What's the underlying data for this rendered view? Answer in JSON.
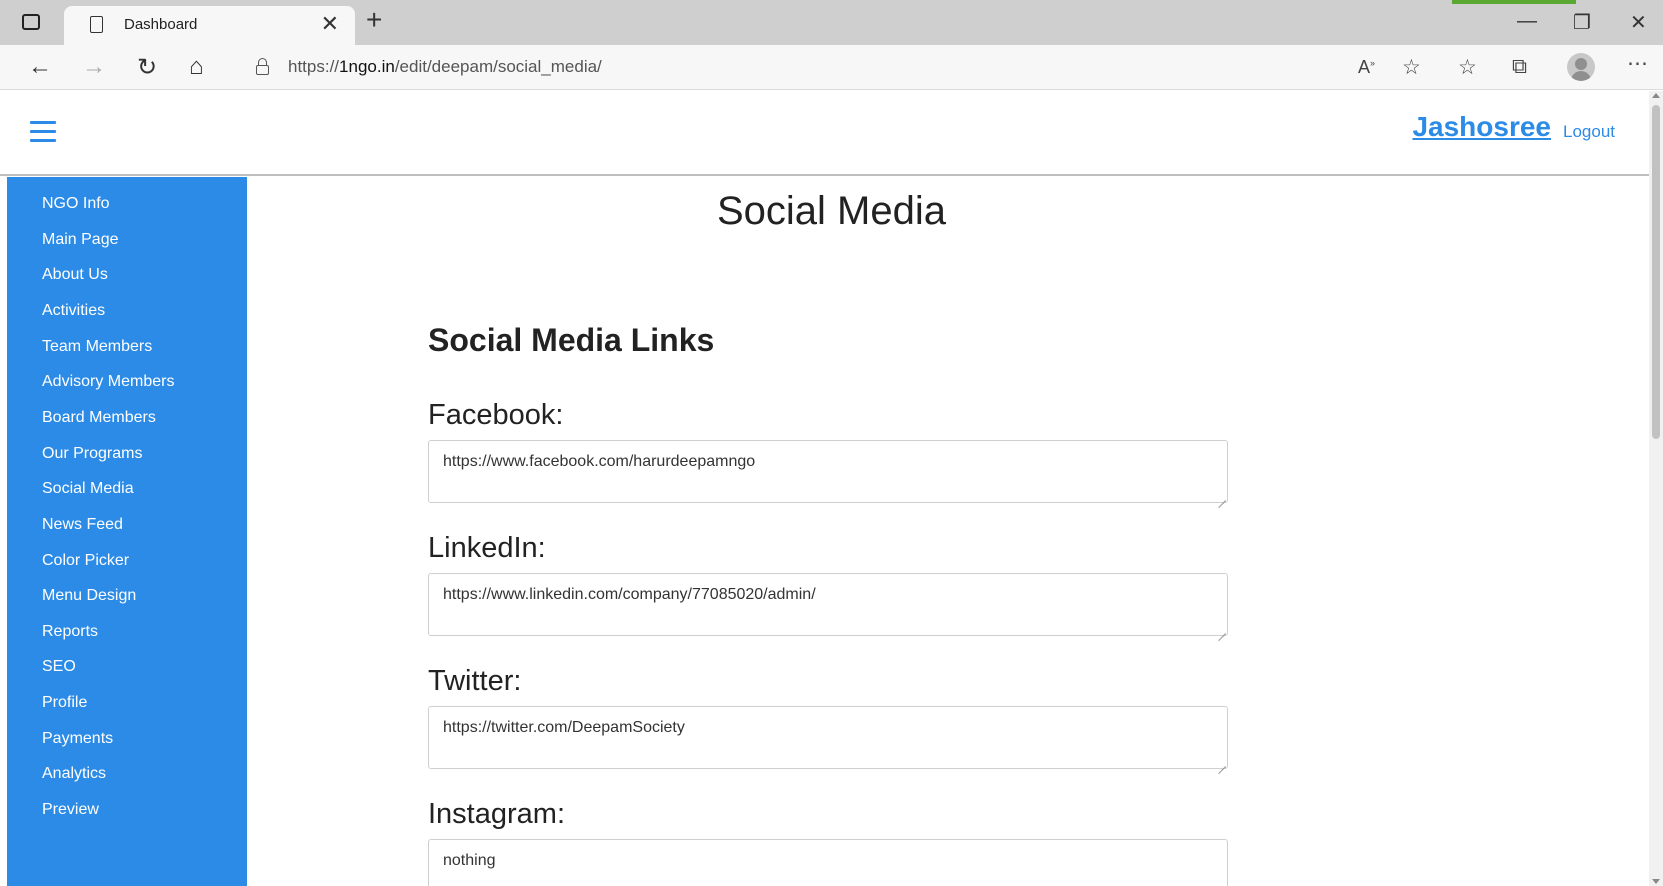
{
  "browser": {
    "tab_title": "Dashboard",
    "url_prefix": "https://",
    "url_domain": "1ngo.in",
    "url_path": "/edit/deepam/social_media/",
    "read_aloud_label": "A"
  },
  "header": {
    "user_name": "Jashosree",
    "logout_label": "Logout"
  },
  "sidebar": {
    "items": [
      {
        "label": "NGO Info"
      },
      {
        "label": "Main Page"
      },
      {
        "label": "About Us"
      },
      {
        "label": "Activities"
      },
      {
        "label": "Team Members"
      },
      {
        "label": "Advisory Members"
      },
      {
        "label": "Board Members"
      },
      {
        "label": "Our Programs"
      },
      {
        "label": "Social Media"
      },
      {
        "label": "News Feed"
      },
      {
        "label": "Color Picker"
      },
      {
        "label": "Menu Design"
      },
      {
        "label": "Reports"
      },
      {
        "label": "SEO"
      },
      {
        "label": "Profile"
      },
      {
        "label": "Payments"
      },
      {
        "label": "Analytics"
      },
      {
        "label": "Preview"
      }
    ]
  },
  "main": {
    "page_title": "Social Media",
    "section_title": "Social Media Links",
    "fields": [
      {
        "label": "Facebook:",
        "value": "https://www.facebook.com/harurdeepamngo"
      },
      {
        "label": "LinkedIn:",
        "value": "https://www.linkedin.com/company/77085020/admin/"
      },
      {
        "label": "Twitter:",
        "value": "https://twitter.com/DeepamSociety"
      },
      {
        "label": "Instagram:",
        "value": "nothing"
      }
    ]
  },
  "colors": {
    "accent": "#2b8be6",
    "sidebar_bg": "#2b8be6"
  }
}
